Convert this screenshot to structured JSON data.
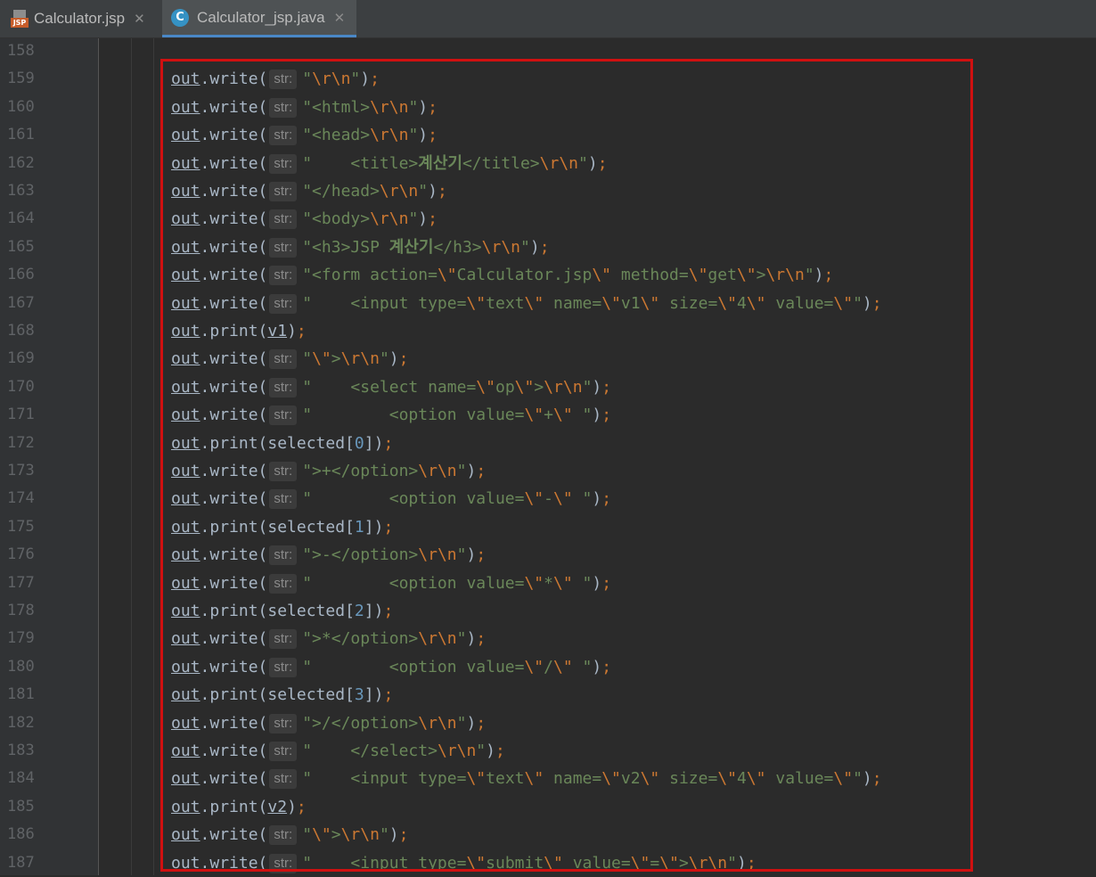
{
  "tabs": [
    {
      "label": "Calculator.jsp",
      "icon": "jsp-file-icon",
      "active": false
    },
    {
      "label": "Calculator_jsp.java",
      "icon": "java-class-icon",
      "active": true
    }
  ],
  "colors": {
    "background": "#2b2b2b",
    "gutter": "#313335",
    "string": "#6a8759",
    "escape": "#cc7832",
    "number": "#6897bb",
    "identifier": "#a9b7c6",
    "highlight_border": "#d01010",
    "active_tab_underline": "#4a88c7"
  },
  "param_hint": "str:",
  "lines": [
    {
      "num": "158",
      "tokens": []
    },
    {
      "num": "159",
      "tokens": [
        [
          "obj",
          "out"
        ],
        [
          "p",
          ".write("
        ],
        [
          "hint",
          "str:"
        ],
        [
          "s",
          "\""
        ],
        [
          "e",
          "\\r\\n"
        ],
        [
          "s",
          "\""
        ],
        [
          "p",
          ")"
        ],
        [
          "k",
          ";"
        ]
      ]
    },
    {
      "num": "160",
      "tokens": [
        [
          "obj",
          "out"
        ],
        [
          "p",
          ".write("
        ],
        [
          "hint",
          "str:"
        ],
        [
          "s",
          "\"<html>"
        ],
        [
          "e",
          "\\r\\n"
        ],
        [
          "s",
          "\""
        ],
        [
          "p",
          ")"
        ],
        [
          "k",
          ";"
        ]
      ]
    },
    {
      "num": "161",
      "tokens": [
        [
          "obj",
          "out"
        ],
        [
          "p",
          ".write("
        ],
        [
          "hint",
          "str:"
        ],
        [
          "s",
          "\"<head>"
        ],
        [
          "e",
          "\\r\\n"
        ],
        [
          "s",
          "\""
        ],
        [
          "p",
          ")"
        ],
        [
          "k",
          ";"
        ]
      ]
    },
    {
      "num": "162",
      "tokens": [
        [
          "obj",
          "out"
        ],
        [
          "p",
          ".write("
        ],
        [
          "hint",
          "str:"
        ],
        [
          "s",
          "\"    <title>"
        ],
        [
          "kr",
          "계산기"
        ],
        [
          "s",
          "</title>"
        ],
        [
          "e",
          "\\r\\n"
        ],
        [
          "s",
          "\""
        ],
        [
          "p",
          ")"
        ],
        [
          "k",
          ";"
        ]
      ]
    },
    {
      "num": "163",
      "tokens": [
        [
          "obj",
          "out"
        ],
        [
          "p",
          ".write("
        ],
        [
          "hint",
          "str:"
        ],
        [
          "s",
          "\"</head>"
        ],
        [
          "e",
          "\\r\\n"
        ],
        [
          "s",
          "\""
        ],
        [
          "p",
          ")"
        ],
        [
          "k",
          ";"
        ]
      ]
    },
    {
      "num": "164",
      "tokens": [
        [
          "obj",
          "out"
        ],
        [
          "p",
          ".write("
        ],
        [
          "hint",
          "str:"
        ],
        [
          "s",
          "\"<body>"
        ],
        [
          "e",
          "\\r\\n"
        ],
        [
          "s",
          "\""
        ],
        [
          "p",
          ")"
        ],
        [
          "k",
          ";"
        ]
      ]
    },
    {
      "num": "165",
      "tokens": [
        [
          "obj",
          "out"
        ],
        [
          "p",
          ".write("
        ],
        [
          "hint",
          "str:"
        ],
        [
          "s",
          "\"<h3>JSP "
        ],
        [
          "kr",
          "계산기"
        ],
        [
          "s",
          "</h3>"
        ],
        [
          "e",
          "\\r\\n"
        ],
        [
          "s",
          "\""
        ],
        [
          "p",
          ")"
        ],
        [
          "k",
          ";"
        ]
      ]
    },
    {
      "num": "166",
      "tokens": [
        [
          "obj",
          "out"
        ],
        [
          "p",
          ".write("
        ],
        [
          "hint",
          "str:"
        ],
        [
          "s",
          "\"<form action="
        ],
        [
          "e",
          "\\\""
        ],
        [
          "s",
          "Calculator.jsp"
        ],
        [
          "e",
          "\\\""
        ],
        [
          "s",
          " method="
        ],
        [
          "e",
          "\\\""
        ],
        [
          "s",
          "get"
        ],
        [
          "e",
          "\\\""
        ],
        [
          "s",
          ">"
        ],
        [
          "e",
          "\\r\\n"
        ],
        [
          "s",
          "\""
        ],
        [
          "p",
          ")"
        ],
        [
          "k",
          ";"
        ]
      ]
    },
    {
      "num": "167",
      "tokens": [
        [
          "obj",
          "out"
        ],
        [
          "p",
          ".write("
        ],
        [
          "hint",
          "str:"
        ],
        [
          "s",
          "\"    <input type="
        ],
        [
          "e",
          "\\\""
        ],
        [
          "s",
          "text"
        ],
        [
          "e",
          "\\\""
        ],
        [
          "s",
          " name="
        ],
        [
          "e",
          "\\\""
        ],
        [
          "s",
          "v1"
        ],
        [
          "e",
          "\\\""
        ],
        [
          "s",
          " size="
        ],
        [
          "e",
          "\\\""
        ],
        [
          "s",
          "4"
        ],
        [
          "e",
          "\\\""
        ],
        [
          "s",
          " value="
        ],
        [
          "e",
          "\\\""
        ],
        [
          "s",
          "\""
        ],
        [
          "p",
          ")"
        ],
        [
          "k",
          ";"
        ]
      ]
    },
    {
      "num": "168",
      "tokens": [
        [
          "obj",
          "out"
        ],
        [
          "p",
          ".print("
        ],
        [
          "obj",
          "v1"
        ],
        [
          "p",
          ")"
        ],
        [
          "k",
          ";"
        ]
      ]
    },
    {
      "num": "169",
      "tokens": [
        [
          "obj",
          "out"
        ],
        [
          "p",
          ".write("
        ],
        [
          "hint",
          "str:"
        ],
        [
          "s",
          "\""
        ],
        [
          "e",
          "\\\""
        ],
        [
          "s",
          ">"
        ],
        [
          "e",
          "\\r\\n"
        ],
        [
          "s",
          "\""
        ],
        [
          "p",
          ")"
        ],
        [
          "k",
          ";"
        ]
      ]
    },
    {
      "num": "170",
      "tokens": [
        [
          "obj",
          "out"
        ],
        [
          "p",
          ".write("
        ],
        [
          "hint",
          "str:"
        ],
        [
          "s",
          "\"    <select name="
        ],
        [
          "e",
          "\\\""
        ],
        [
          "s",
          "op"
        ],
        [
          "e",
          "\\\""
        ],
        [
          "s",
          ">"
        ],
        [
          "e",
          "\\r\\n"
        ],
        [
          "s",
          "\""
        ],
        [
          "p",
          ")"
        ],
        [
          "k",
          ";"
        ]
      ]
    },
    {
      "num": "171",
      "tokens": [
        [
          "obj",
          "out"
        ],
        [
          "p",
          ".write("
        ],
        [
          "hint",
          "str:"
        ],
        [
          "s",
          "\"        <option value="
        ],
        [
          "e",
          "\\\""
        ],
        [
          "s",
          "+"
        ],
        [
          "e",
          "\\\""
        ],
        [
          "s",
          " \""
        ],
        [
          "p",
          ")"
        ],
        [
          "k",
          ";"
        ]
      ]
    },
    {
      "num": "172",
      "tokens": [
        [
          "obj",
          "out"
        ],
        [
          "p",
          ".print(selected["
        ],
        [
          "n",
          "0"
        ],
        [
          "p",
          "])"
        ],
        [
          "k",
          ";"
        ]
      ]
    },
    {
      "num": "173",
      "tokens": [
        [
          "obj",
          "out"
        ],
        [
          "p",
          ".write("
        ],
        [
          "hint",
          "str:"
        ],
        [
          "s",
          "\">+</option>"
        ],
        [
          "e",
          "\\r\\n"
        ],
        [
          "s",
          "\""
        ],
        [
          "p",
          ")"
        ],
        [
          "k",
          ";"
        ]
      ]
    },
    {
      "num": "174",
      "tokens": [
        [
          "obj",
          "out"
        ],
        [
          "p",
          ".write("
        ],
        [
          "hint",
          "str:"
        ],
        [
          "s",
          "\"        <option value="
        ],
        [
          "e",
          "\\\""
        ],
        [
          "s",
          "-"
        ],
        [
          "e",
          "\\\""
        ],
        [
          "s",
          " \""
        ],
        [
          "p",
          ")"
        ],
        [
          "k",
          ";"
        ]
      ]
    },
    {
      "num": "175",
      "tokens": [
        [
          "obj",
          "out"
        ],
        [
          "p",
          ".print(selected["
        ],
        [
          "n",
          "1"
        ],
        [
          "p",
          "])"
        ],
        [
          "k",
          ";"
        ]
      ]
    },
    {
      "num": "176",
      "tokens": [
        [
          "obj",
          "out"
        ],
        [
          "p",
          ".write("
        ],
        [
          "hint",
          "str:"
        ],
        [
          "s",
          "\">-</option>"
        ],
        [
          "e",
          "\\r\\n"
        ],
        [
          "s",
          "\""
        ],
        [
          "p",
          ")"
        ],
        [
          "k",
          ";"
        ]
      ]
    },
    {
      "num": "177",
      "tokens": [
        [
          "obj",
          "out"
        ],
        [
          "p",
          ".write("
        ],
        [
          "hint",
          "str:"
        ],
        [
          "s",
          "\"        <option value="
        ],
        [
          "e",
          "\\\""
        ],
        [
          "s",
          "*"
        ],
        [
          "e",
          "\\\""
        ],
        [
          "s",
          " \""
        ],
        [
          "p",
          ")"
        ],
        [
          "k",
          ";"
        ]
      ]
    },
    {
      "num": "178",
      "tokens": [
        [
          "obj",
          "out"
        ],
        [
          "p",
          ".print(selected["
        ],
        [
          "n",
          "2"
        ],
        [
          "p",
          "])"
        ],
        [
          "k",
          ";"
        ]
      ]
    },
    {
      "num": "179",
      "tokens": [
        [
          "obj",
          "out"
        ],
        [
          "p",
          ".write("
        ],
        [
          "hint",
          "str:"
        ],
        [
          "s",
          "\">*</option>"
        ],
        [
          "e",
          "\\r\\n"
        ],
        [
          "s",
          "\""
        ],
        [
          "p",
          ")"
        ],
        [
          "k",
          ";"
        ]
      ]
    },
    {
      "num": "180",
      "tokens": [
        [
          "obj",
          "out"
        ],
        [
          "p",
          ".write("
        ],
        [
          "hint",
          "str:"
        ],
        [
          "s",
          "\"        <option value="
        ],
        [
          "e",
          "\\\""
        ],
        [
          "s",
          "/"
        ],
        [
          "e",
          "\\\""
        ],
        [
          "s",
          " \""
        ],
        [
          "p",
          ")"
        ],
        [
          "k",
          ";"
        ]
      ]
    },
    {
      "num": "181",
      "tokens": [
        [
          "obj",
          "out"
        ],
        [
          "p",
          ".print(selected["
        ],
        [
          "n",
          "3"
        ],
        [
          "p",
          "])"
        ],
        [
          "k",
          ";"
        ]
      ]
    },
    {
      "num": "182",
      "tokens": [
        [
          "obj",
          "out"
        ],
        [
          "p",
          ".write("
        ],
        [
          "hint",
          "str:"
        ],
        [
          "s",
          "\">/</option>"
        ],
        [
          "e",
          "\\r\\n"
        ],
        [
          "s",
          "\""
        ],
        [
          "p",
          ")"
        ],
        [
          "k",
          ";"
        ]
      ]
    },
    {
      "num": "183",
      "tokens": [
        [
          "obj",
          "out"
        ],
        [
          "p",
          ".write("
        ],
        [
          "hint",
          "str:"
        ],
        [
          "s",
          "\"    </select>"
        ],
        [
          "e",
          "\\r\\n"
        ],
        [
          "s",
          "\""
        ],
        [
          "p",
          ")"
        ],
        [
          "k",
          ";"
        ]
      ]
    },
    {
      "num": "184",
      "tokens": [
        [
          "obj",
          "out"
        ],
        [
          "p",
          ".write("
        ],
        [
          "hint",
          "str:"
        ],
        [
          "s",
          "\"    <input type="
        ],
        [
          "e",
          "\\\""
        ],
        [
          "s",
          "text"
        ],
        [
          "e",
          "\\\""
        ],
        [
          "s",
          " name="
        ],
        [
          "e",
          "\\\""
        ],
        [
          "s",
          "v2"
        ],
        [
          "e",
          "\\\""
        ],
        [
          "s",
          " size="
        ],
        [
          "e",
          "\\\""
        ],
        [
          "s",
          "4"
        ],
        [
          "e",
          "\\\""
        ],
        [
          "s",
          " value="
        ],
        [
          "e",
          "\\\""
        ],
        [
          "s",
          "\""
        ],
        [
          "p",
          ")"
        ],
        [
          "k",
          ";"
        ]
      ]
    },
    {
      "num": "185",
      "tokens": [
        [
          "obj",
          "out"
        ],
        [
          "p",
          ".print("
        ],
        [
          "obj",
          "v2"
        ],
        [
          "p",
          ")"
        ],
        [
          "k",
          ";"
        ]
      ]
    },
    {
      "num": "186",
      "tokens": [
        [
          "obj",
          "out"
        ],
        [
          "p",
          ".write("
        ],
        [
          "hint",
          "str:"
        ],
        [
          "s",
          "\""
        ],
        [
          "e",
          "\\\""
        ],
        [
          "s",
          ">"
        ],
        [
          "e",
          "\\r\\n"
        ],
        [
          "s",
          "\""
        ],
        [
          "p",
          ")"
        ],
        [
          "k",
          ";"
        ]
      ]
    },
    {
      "num": "187",
      "tokens": [
        [
          "obj",
          "out"
        ],
        [
          "p",
          ".write("
        ],
        [
          "hint",
          "str:"
        ],
        [
          "s",
          "\"    <input type="
        ],
        [
          "e",
          "\\\""
        ],
        [
          "s",
          "submit"
        ],
        [
          "e",
          "\\\""
        ],
        [
          "s",
          " value="
        ],
        [
          "e",
          "\\\""
        ],
        [
          "s",
          "="
        ],
        [
          "e",
          "\\\""
        ],
        [
          "s",
          ">"
        ],
        [
          "e",
          "\\r\\n"
        ],
        [
          "s",
          "\""
        ],
        [
          "p",
          ")"
        ],
        [
          "k",
          ";"
        ]
      ]
    }
  ]
}
